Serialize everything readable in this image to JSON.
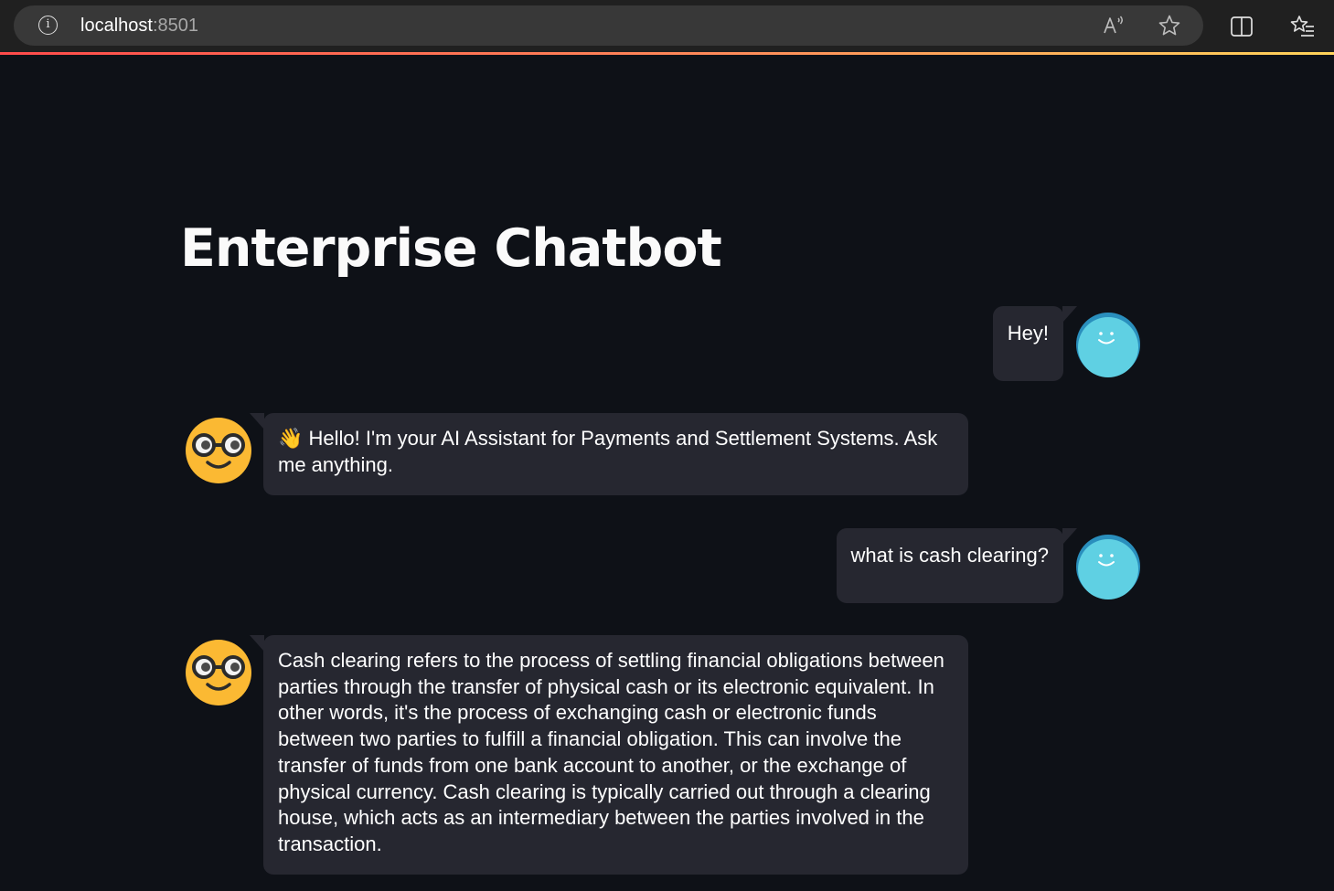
{
  "browser": {
    "url_host": "localhost",
    "url_port": ":8501",
    "icons": [
      "info-icon",
      "read-aloud-icon",
      "favorite-star-icon",
      "split-screen-icon",
      "favorites-list-icon"
    ]
  },
  "colors": {
    "background": "#0e1117",
    "bubble": "#262730",
    "user_avatar": "#5fd0e3",
    "bot_avatar": "#fbb933",
    "accent_start": "#ff4b4b",
    "accent_end": "#ffd45a"
  },
  "app": {
    "title": "Enterprise Chatbot"
  },
  "messages": [
    {
      "role": "user",
      "avatar": "smiling-bubble-avatar",
      "text": "Hey!"
    },
    {
      "role": "assistant",
      "avatar": "nerd-face-avatar",
      "emoji": "👋",
      "text": "Hello! I'm your AI Assistant for Payments and Settlement Systems. Ask me anything."
    },
    {
      "role": "user",
      "avatar": "smiling-bubble-avatar",
      "text": "what is cash clearing?"
    },
    {
      "role": "assistant",
      "avatar": "nerd-face-avatar",
      "text": "Cash clearing refers to the process of settling financial obligations between parties through the transfer of physical cash or its electronic equivalent. In other words, it's the process of exchanging cash or electronic funds between two parties to fulfill a financial obligation. This can involve the transfer of funds from one bank account to another, or the exchange of physical currency. Cash clearing is typically carried out through a clearing house, which acts as an intermediary between the parties involved in the transaction."
    }
  ]
}
